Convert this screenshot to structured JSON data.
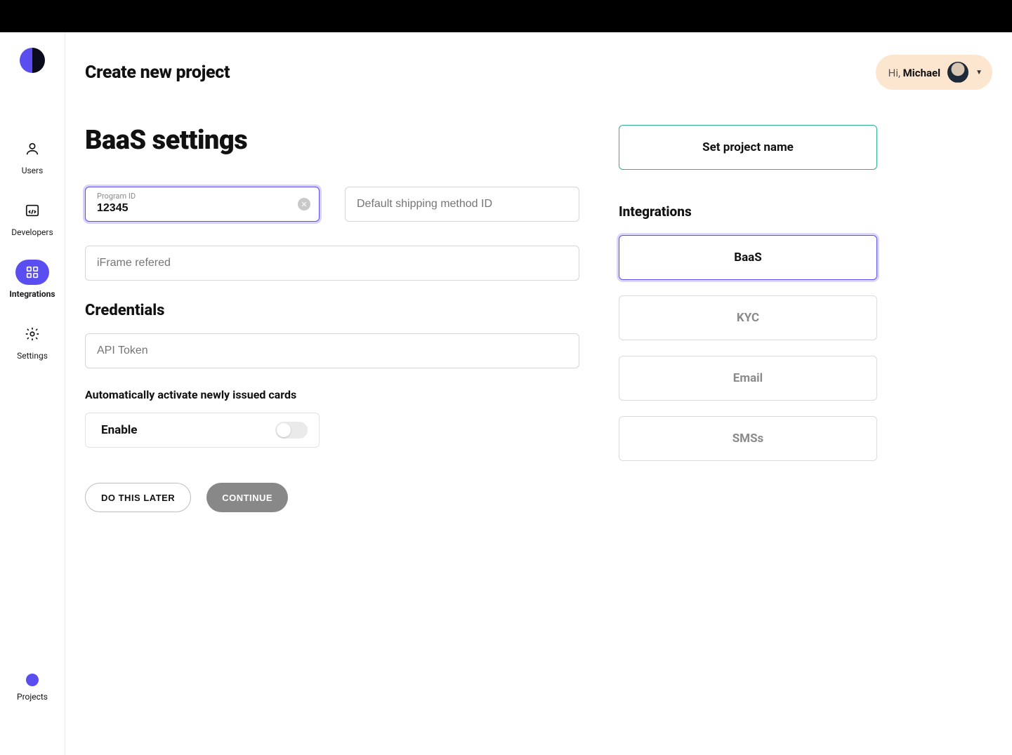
{
  "header": {
    "title": "Create new project",
    "greeting_prefix": "Hi, ",
    "user_name": "Michael"
  },
  "sidebar": {
    "items": [
      {
        "id": "users",
        "label": "Users"
      },
      {
        "id": "developers",
        "label": "Developers"
      },
      {
        "id": "integrations",
        "label": "Integrations"
      },
      {
        "id": "settings",
        "label": "Settings"
      }
    ],
    "bottom": {
      "label": "Projects"
    }
  },
  "main": {
    "title": "BaaS settings",
    "fields": {
      "program_id": {
        "label": "Program ID",
        "value": "12345"
      },
      "shipping": {
        "placeholder": "Default shipping method ID"
      },
      "iframe": {
        "placeholder": "iFrame refered"
      },
      "api_token": {
        "placeholder": "API Token"
      }
    },
    "credentials_title": "Credentials",
    "auto_activate": {
      "heading": "Automatically activate newly issued cards",
      "toggle_label": "Enable",
      "enabled": false
    },
    "buttons": {
      "later": "DO THIS LATER",
      "continue": "CONTINUE"
    }
  },
  "right": {
    "project_name_step": "Set project name",
    "integrations_title": "Integrations",
    "integrations": [
      {
        "label": "BaaS",
        "selected": true
      },
      {
        "label": "KYC",
        "selected": false
      },
      {
        "label": "Email",
        "selected": false
      },
      {
        "label": "SMSs",
        "selected": false
      }
    ]
  }
}
